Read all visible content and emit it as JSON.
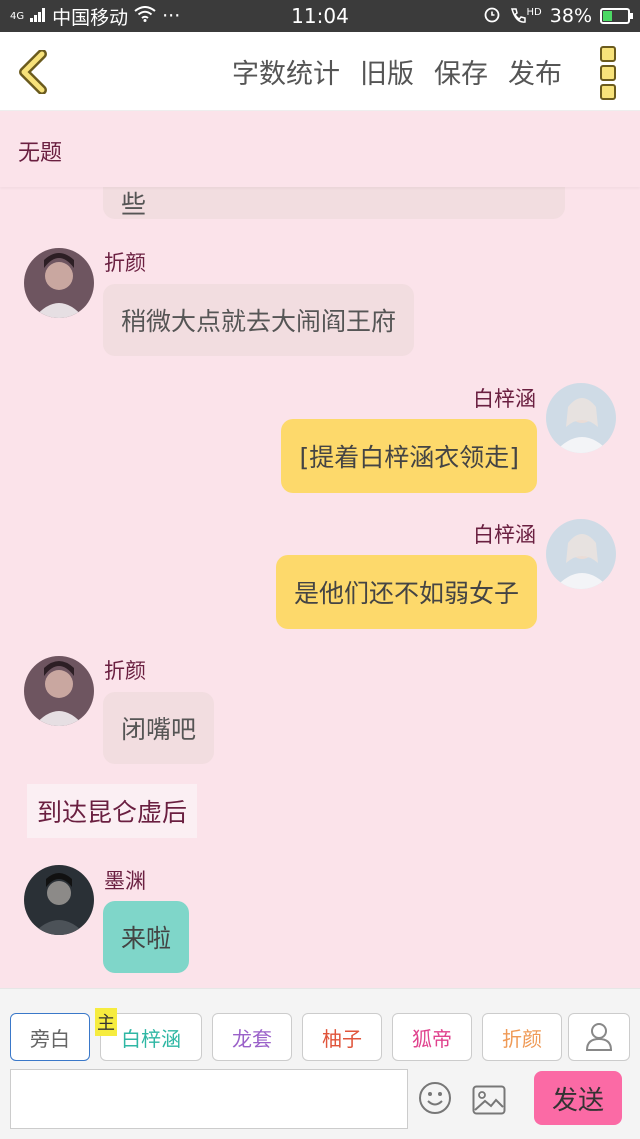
{
  "status": {
    "carrier": "中国移动",
    "network": "4G",
    "more": "···",
    "time": "11:04",
    "hd": "HD",
    "battery": "38%",
    "battery_level": 0.38
  },
  "topbar": {
    "word_count": "字数统计",
    "old_version": "旧版",
    "save": "保存",
    "publish": "发布"
  },
  "title": "无题",
  "messages": {
    "clipped_text": "些",
    "m1": {
      "name": "折颜",
      "text": "稍微大点就去大闹阎王府"
    },
    "m2": {
      "name": "白梓涵",
      "text": "[提着白梓涵衣领走]"
    },
    "m3": {
      "name": "白梓涵",
      "text": "是他们还不如弱女子"
    },
    "m4": {
      "name": "折颜",
      "text": "闭嘴吧"
    },
    "narration": "到达昆仑虚后",
    "m5": {
      "name": "墨渊",
      "text": "来啦"
    }
  },
  "characters": {
    "narrator": "旁白",
    "main_tag": "主",
    "c1": "白梓涵",
    "c2": "龙套",
    "c3": "柚子",
    "c4": "狐帝",
    "c5": "折颜"
  },
  "colors": {
    "c1": "#2fb7a4",
    "c2": "#9a61c9",
    "c3": "#e0553b",
    "c4": "#e0438e",
    "c5": "#ef9a56"
  },
  "input": {
    "placeholder": ""
  },
  "send_label": "发送",
  "icons": {
    "back": "chevron-left-icon",
    "menu": "more-vertical-icon",
    "emoji": "smiley-icon",
    "image": "image-icon",
    "person": "person-icon"
  }
}
